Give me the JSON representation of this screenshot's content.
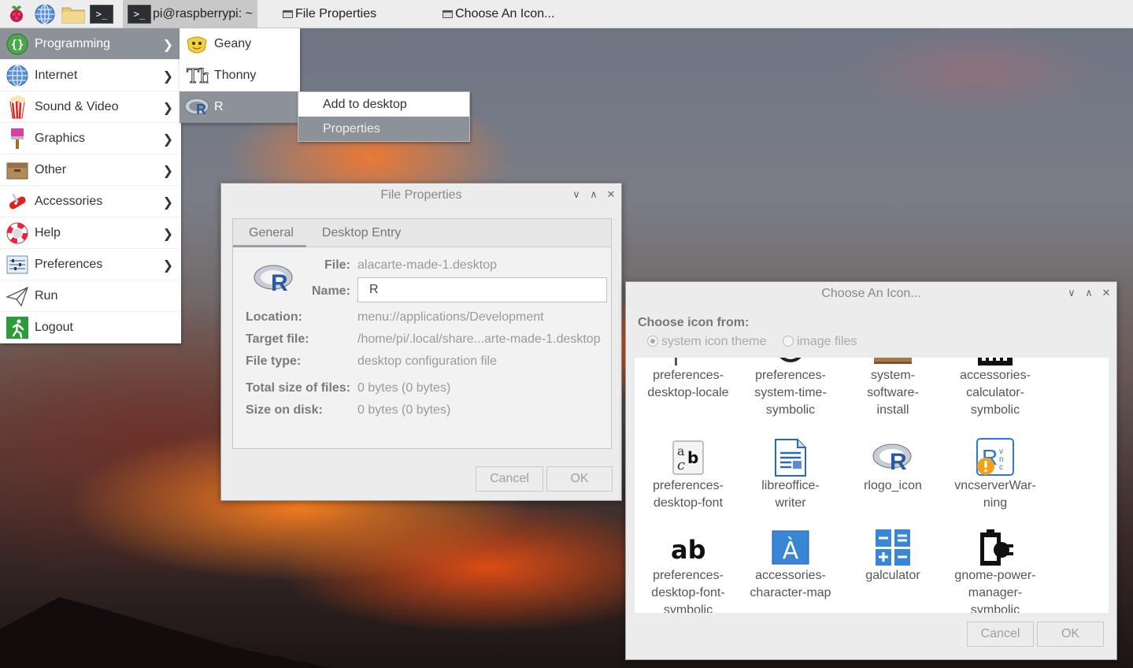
{
  "taskbar": {
    "tasks": [
      {
        "label": "pi@raspberrypi: ~"
      },
      {
        "label": "File Properties"
      },
      {
        "label": "Choose An Icon..."
      }
    ]
  },
  "menu": {
    "items": [
      {
        "label": "Programming",
        "icon": "braces-icon"
      },
      {
        "label": "Internet",
        "icon": "globe-icon"
      },
      {
        "label": "Sound & Video",
        "icon": "popcorn-icon"
      },
      {
        "label": "Graphics",
        "icon": "paintbrush-icon"
      },
      {
        "label": "Other",
        "icon": "box-icon"
      },
      {
        "label": "Accessories",
        "icon": "swiss-knife-icon"
      },
      {
        "label": "Help",
        "icon": "lifebuoy-icon"
      },
      {
        "label": "Preferences",
        "icon": "sliders-icon"
      },
      {
        "label": "Run",
        "icon": "paper-plane-icon"
      },
      {
        "label": "Logout",
        "icon": "exit-icon"
      }
    ],
    "submenu": [
      {
        "label": "Geany",
        "icon": "geany-icon"
      },
      {
        "label": "Thonny",
        "icon": "thonny-icon"
      },
      {
        "label": "R",
        "icon": "r-logo-icon"
      }
    ],
    "context": [
      {
        "label": "Add to desktop"
      },
      {
        "label": "Properties"
      }
    ]
  },
  "file_properties": {
    "title": "File Properties",
    "tabs": [
      "General",
      "Desktop Entry"
    ],
    "file_label": "File:",
    "file_value": "alacarte-made-1.desktop",
    "name_label": "Name:",
    "name_value": "R",
    "location_label": "Location:",
    "location_value": "menu://applications/Development",
    "target_label": "Target file:",
    "target_value": "/home/pi/.local/share...arte-made-1.desktop",
    "filetype_label": "File type:",
    "filetype_value": "desktop configuration file",
    "totalsize_label": "Total size of files:",
    "totalsize_value": "0 bytes (0 bytes)",
    "disksize_label": "Size on disk:",
    "disksize_value": "0 bytes (0 bytes)",
    "cancel": "Cancel",
    "ok": "OK"
  },
  "icon_chooser": {
    "title": "Choose An Icon...",
    "choose_from": "Choose icon from:",
    "option_theme": "system icon theme",
    "option_files": "image files",
    "icons": [
      {
        "l1": "preferences-",
        "l2": "desktop-locale",
        "l3": ""
      },
      {
        "l1": "preferences-",
        "l2": "system-time-",
        "l3": "symbolic"
      },
      {
        "l1": "system-",
        "l2": "software-",
        "l3": "install"
      },
      {
        "l1": "accessories-",
        "l2": "calculator-",
        "l3": "symbolic"
      },
      {
        "l1": "preferences-",
        "l2": "desktop-font",
        "l3": ""
      },
      {
        "l1": "libreoffice-",
        "l2": "writer",
        "l3": ""
      },
      {
        "l1": "rlogo_icon",
        "l2": "",
        "l3": ""
      },
      {
        "l1": "vncserverWar-",
        "l2": "ning",
        "l3": ""
      },
      {
        "l1": "preferences-",
        "l2": "desktop-font-",
        "l3": "symbolic"
      },
      {
        "l1": "accessories-",
        "l2": "character-map",
        "l3": ""
      },
      {
        "l1": "galculator",
        "l2": "",
        "l3": ""
      },
      {
        "l1": "gnome-power-",
        "l2": "manager-",
        "l3": "symbolic"
      }
    ],
    "cancel": "Cancel",
    "ok": "OK"
  }
}
